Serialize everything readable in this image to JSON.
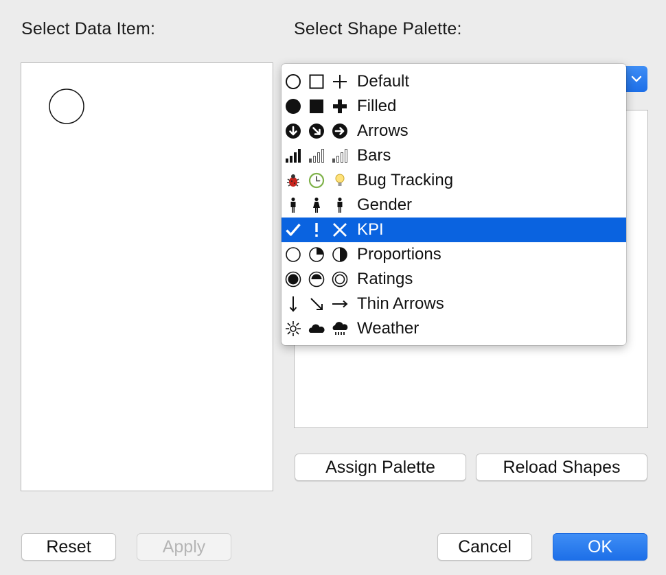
{
  "left": {
    "title": "Select Data Item:"
  },
  "right": {
    "title": "Select Shape Palette:"
  },
  "menu": {
    "items": [
      {
        "label": "Default",
        "icons": [
          "circle-outline-icon",
          "square-outline-icon",
          "plus-thin-icon"
        ]
      },
      {
        "label": "Filled",
        "icons": [
          "circle-filled-icon",
          "square-filled-icon",
          "plus-filled-icon"
        ]
      },
      {
        "label": "Arrows",
        "icons": [
          "arrow-down-circle-icon",
          "arrow-downright-circle-icon",
          "arrow-right-circle-icon"
        ]
      },
      {
        "label": "Bars",
        "icons": [
          "bars-full-icon",
          "bars-partial-icon",
          "bars-partial-icon"
        ]
      },
      {
        "label": "Bug Tracking",
        "icons": [
          "bug-icon",
          "clock-icon",
          "lightbulb-icon"
        ]
      },
      {
        "label": "Gender",
        "icons": [
          "male-icon",
          "female-icon",
          "male-icon"
        ]
      },
      {
        "label": "KPI",
        "icons": [
          "check-icon",
          "exclamation-icon",
          "x-icon"
        ],
        "selected": true
      },
      {
        "label": "Proportions",
        "icons": [
          "pie-empty-icon",
          "pie-quarter-icon",
          "pie-half-icon"
        ]
      },
      {
        "label": "Ratings",
        "icons": [
          "rating-full-icon",
          "rating-half-icon",
          "rating-ring-icon"
        ]
      },
      {
        "label": "Thin Arrows",
        "icons": [
          "thin-arrow-down-icon",
          "thin-arrow-downright-icon",
          "thin-arrow-right-icon"
        ]
      },
      {
        "label": "Weather",
        "icons": [
          "sun-icon",
          "cloud-icon",
          "rain-cloud-icon"
        ]
      }
    ]
  },
  "buttons": {
    "assign_palette": "Assign Palette",
    "reload_shapes": "Reload Shapes",
    "reset": "Reset",
    "apply": "Apply",
    "cancel": "Cancel",
    "ok": "OK"
  },
  "colors": {
    "accent": "#1d6fe8",
    "selection": "#0a63e0"
  }
}
